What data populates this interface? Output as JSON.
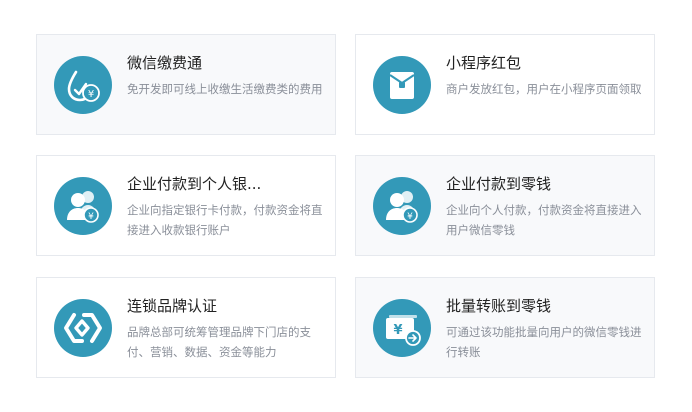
{
  "cards": [
    {
      "title": "微信缴费通",
      "desc": "免开发即可线上收缴生活缴费类的费用",
      "icon": "payment-water-drop-icon"
    },
    {
      "title": "小程序红包",
      "desc": "商户发放红包，用户在小程序页面领取",
      "icon": "red-envelope-icon"
    },
    {
      "title": "企业付款到个人银...",
      "desc": "企业向指定银行卡付款，付款资金将直接进入收款银行账户",
      "icon": "users-payment-icon"
    },
    {
      "title": "企业付款到零钱",
      "desc": "企业向个人付款，付款资金将直接进入用户微信零钱",
      "icon": "users-payment-icon"
    },
    {
      "title": "连锁品牌认证",
      "desc": "品牌总部可统筹管理品牌下门店的支付、营销、数据、资金等能力",
      "icon": "chain-link-icon"
    },
    {
      "title": "批量转账到零钱",
      "desc": "可通过该功能批量向用户的微信零钱进行转账",
      "icon": "batch-transfer-icon"
    }
  ],
  "colors": {
    "accent": "#3399b8",
    "title": "#222222",
    "desc": "#8a8f99",
    "border": "#e6e9ee"
  }
}
